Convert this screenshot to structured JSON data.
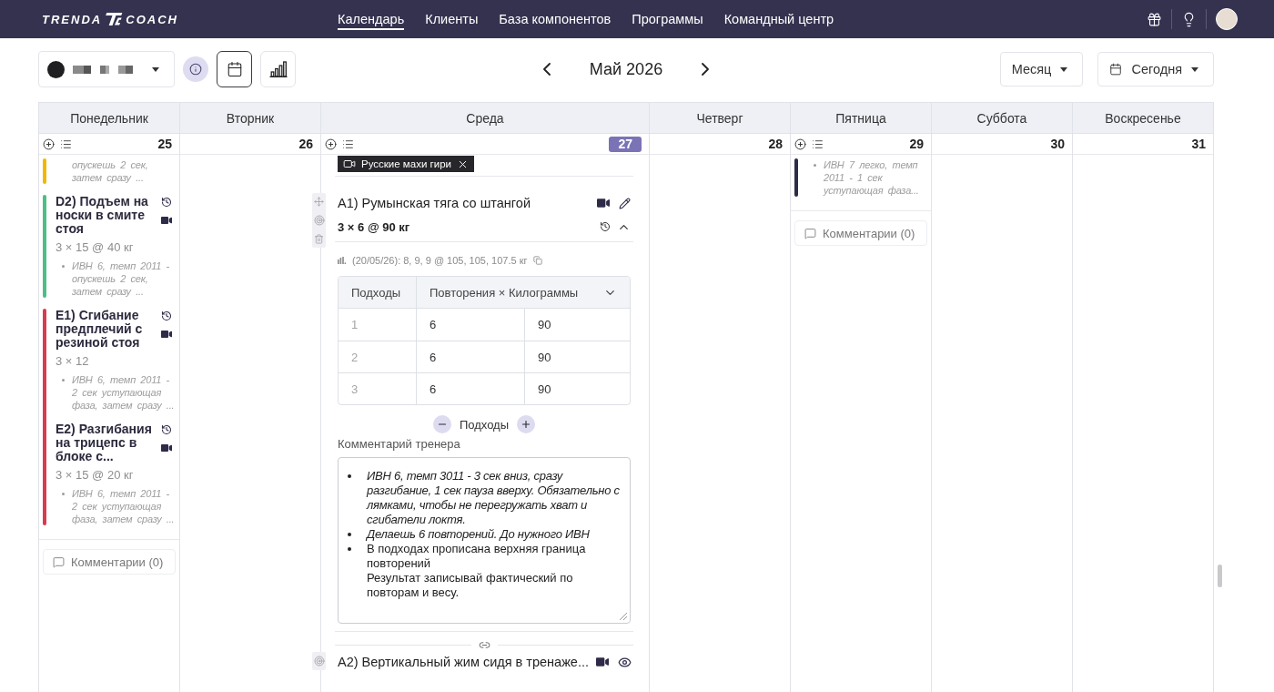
{
  "header": {
    "logo": {
      "left": "TRENDA",
      "right": "COACH"
    },
    "nav": [
      {
        "label": "Календарь",
        "selected": true
      },
      {
        "label": "Клиенты",
        "selected": false
      },
      {
        "label": "База компонентов",
        "selected": false
      },
      {
        "label": "Программы",
        "selected": false
      },
      {
        "label": "Командный центр",
        "selected": false
      }
    ]
  },
  "toolbar": {
    "view_buttons": [
      {
        "kind": "calendar",
        "selected": true
      },
      {
        "kind": "stats",
        "selected": false
      }
    ],
    "period": "Май 2026",
    "view_select": "Месяц",
    "today_button": "Сегодня"
  },
  "calendar": {
    "weekdays": [
      "Понедельник",
      "Вторник",
      "Среда",
      "Четверг",
      "Пятница",
      "Суббота",
      "Воскресенье"
    ],
    "days": [
      {
        "number": "25",
        "today": false,
        "has_workout": true,
        "expanded": false,
        "groups": [
          {
            "color": "#f2b705",
            "exercises": [
              {
                "note": "опускешь 2 сек, затем сразу ...",
                "bullet": false
              }
            ]
          },
          {
            "color": "#4cbf86",
            "exercises": [
              {
                "title": "D2) Подъем на носки в смите стоя",
                "prescription": "3 × 15 @ 40 кг",
                "note": "ИВН 6, темп 2011 - опускешь 2 сек, затем сразу ...",
                "bullet": true
              }
            ]
          },
          {
            "color": "#d63c50",
            "exercises": [
              {
                "title": "E1) Сгибание предплечий с резиной стоя",
                "prescription": "3 × 12",
                "note": "ИВН 6, темп 2011 - 2 сек уступающая фаза, затем сразу ...",
                "bullet": true
              },
              {
                "title": "E2) Разгибания на трицепс в блоке с...",
                "prescription": "3 × 15 @ 20 кг",
                "note": "ИВН 6, темп 2011 - 2 сек уступающая фаза, затем сразу ...",
                "bullet": true
              }
            ]
          }
        ],
        "comments_button": "Комментарии (0)"
      },
      {
        "number": "26",
        "today": false,
        "has_workout": false,
        "expanded": false
      },
      {
        "number": "27",
        "today": true,
        "has_workout": true,
        "expanded": true,
        "video_tag": "Русские махи гири",
        "exercises": [
          {
            "title": "A1) Румынская тяга со штангой",
            "prescription": "3 × 6 @ 90 кг",
            "expanded": true,
            "previous_result": "(20/05/26): 8, 9, 9 @ 105, 105, 107.5 кг",
            "table": {
              "columns": [
                "Подходы",
                "Повторения × Килограммы"
              ],
              "rows": [
                [
                  "1",
                  "6",
                  "90"
                ],
                [
                  "2",
                  "6",
                  "90"
                ],
                [
                  "3",
                  "6",
                  "90"
                ]
              ]
            },
            "sets_label": "Подходы",
            "comment_label": "Комментарий тренера",
            "comment": [
              {
                "italic": true,
                "lines": [
                  "ИВН 6, темп 3011 - 3 сек вниз, сразу разгибание, 1 сек пауза вверху. Обязательно с лямками, чтобы не перегружать хват и сгибатели локтя."
                ]
              },
              {
                "italic": true,
                "lines": [
                  "Делаешь 6 повторений. До нужного ИВН"
                ]
              },
              {
                "italic": false,
                "lines": [
                  "В подходах прописана верхняя граница повторений",
                  "Результат записывай фактический по повторам и весу."
                ]
              }
            ]
          },
          {
            "title": "A2) Вертикальный жим сидя в тренаже...",
            "expanded": false,
            "linked": true
          }
        ]
      },
      {
        "number": "28",
        "today": false,
        "has_workout": false,
        "expanded": false
      },
      {
        "number": "29",
        "today": false,
        "has_workout": true,
        "expanded": false,
        "groups": [
          {
            "color": "#2e2b48",
            "exercises": [
              {
                "note": "ИВН 7 легко, темп 2011 - 1 сек уступающая фаза...",
                "bullet": true
              }
            ]
          }
        ],
        "comments_button": "Комментарии (0)"
      },
      {
        "number": "30",
        "today": false,
        "has_workout": false,
        "expanded": false
      },
      {
        "number": "31",
        "today": false,
        "has_workout": false,
        "expanded": false
      }
    ]
  }
}
